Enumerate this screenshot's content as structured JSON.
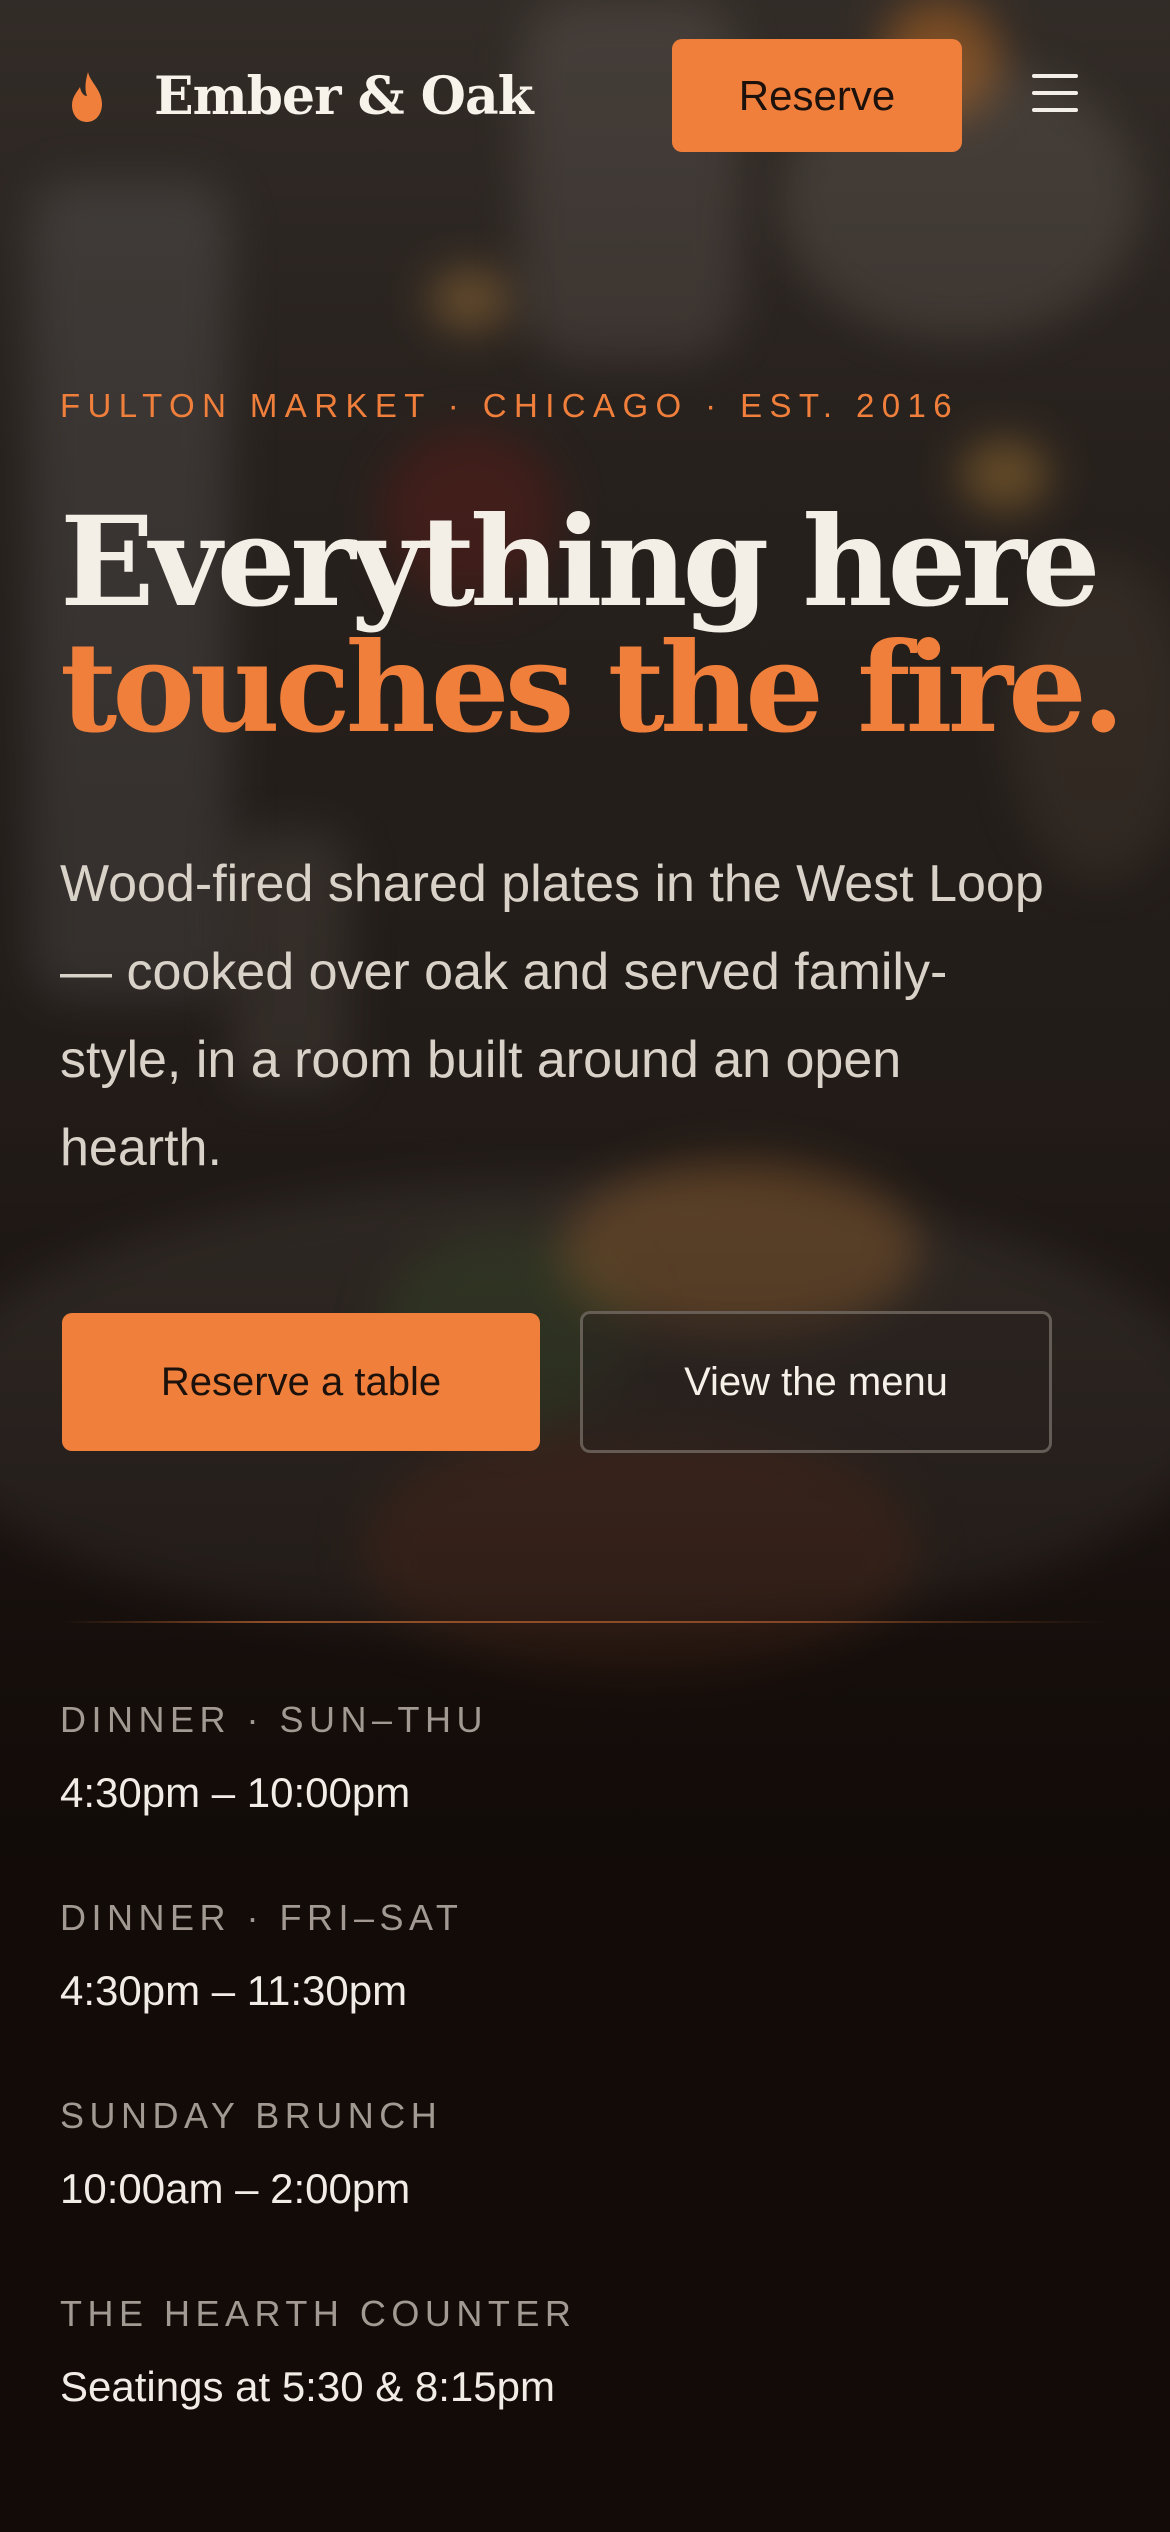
{
  "header": {
    "brand_name": "Ember & Oak",
    "brand_icon": "flame-icon",
    "reserve_label": "Reserve",
    "menu_icon": "hamburger-menu-icon"
  },
  "hero": {
    "eyebrow": "FULTON MARKET · CHICAGO · EST. 2016",
    "headline_line1": "Everything here",
    "headline_line2": "touches the fire.",
    "lede": "Wood-fired shared plates in the West Loop — cooked over oak and served family-style, in a room built around an open hearth.",
    "primary_cta": "Reserve a table",
    "secondary_cta": "View the menu"
  },
  "hours": [
    {
      "label": "DINNER · SUN–THU",
      "value": "4:30pm – 10:00pm"
    },
    {
      "label": "DINNER · FRI–SAT",
      "value": "4:30pm – 11:30pm"
    },
    {
      "label": "SUNDAY BRUNCH",
      "value": "10:00am – 2:00pm"
    },
    {
      "label": "THE HEARTH COUNTER",
      "value": "Seatings at 5:30 & 8:15pm"
    }
  ],
  "colors": {
    "accent": "#f07f3c",
    "background": "#140d0a",
    "text_primary": "#f4efe6",
    "text_muted": "#a29a92"
  }
}
